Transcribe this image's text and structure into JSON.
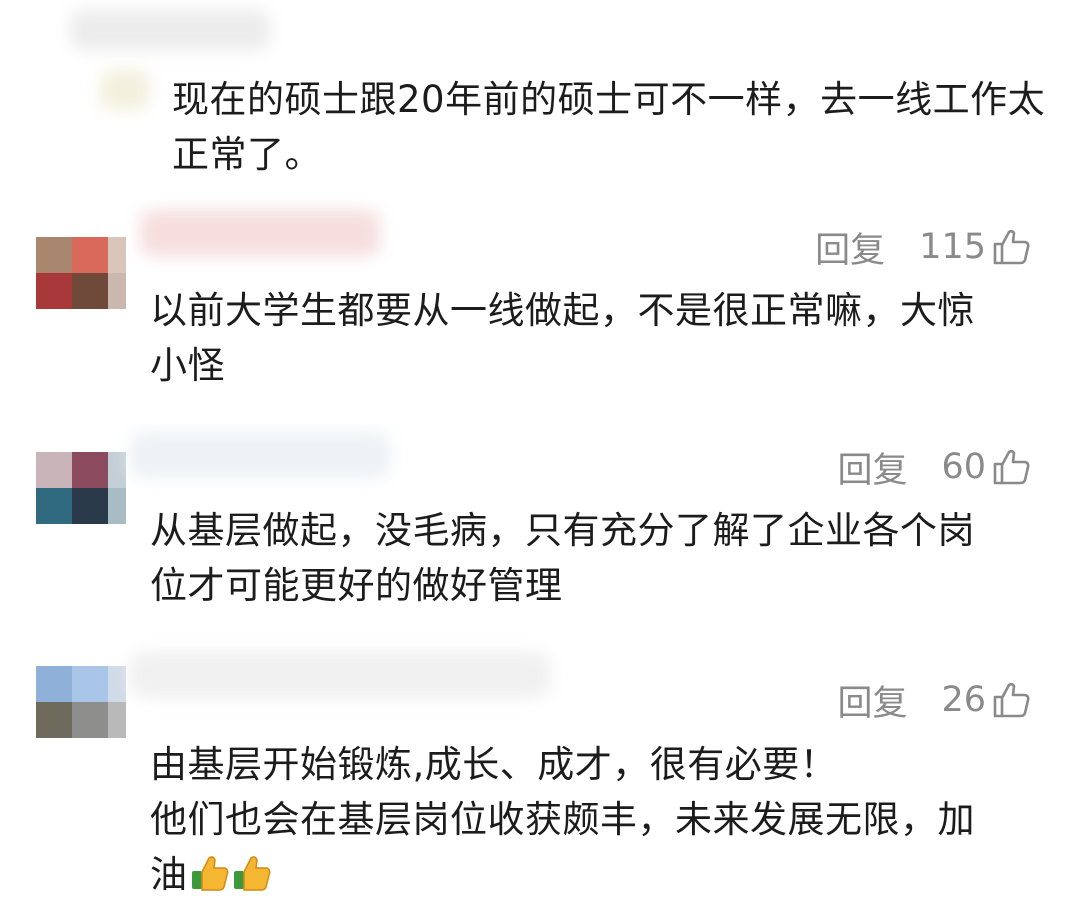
{
  "comments": [
    {
      "text": "现在的硕士跟20年前的硕士可不一样，去一线工作太\n正常了。"
    },
    {
      "reply_label": "回复",
      "likes": "115",
      "text": "以前大学生都要从一线做起，不是很正常嘛，大惊\n小怪",
      "avatar_colors": [
        "#a9876f",
        "#d9695a",
        "#d8c6bb",
        "#a8383a",
        "#6f4a3a",
        "#cab7ad"
      ]
    },
    {
      "reply_label": "回复",
      "likes": "60",
      "text": "从基层做起，没毛病，只有充分了解了企业各个岗\n位才可能更好的做好管理",
      "avatar_colors": [
        "#c9b4b9",
        "#8c4a5e",
        "#c3cfd6",
        "#2f6a80",
        "#2b3a4a",
        "#a8bcc4"
      ]
    },
    {
      "reply_label": "回复",
      "likes": "26",
      "text": "由基层开始锻炼,成长、成才，很有必要！\n他们也会在基层岗位收获颇丰，未来发展无限，加\n油",
      "avatar_colors": [
        "#8fb0d8",
        "#a9c6e9",
        "#d0dbe8",
        "#6e6a5c",
        "#8e8f8d",
        "#b9b9b9"
      ]
    }
  ],
  "icons": {
    "like": "thumbs-up-outline-icon",
    "emoji": "thumbs-up-emoji-icon"
  },
  "colors": {
    "text": "#1c1c1c",
    "meta": "#8a8a8a",
    "emoji_hand": "#f5b731",
    "emoji_cuff": "#3d9a3c"
  }
}
